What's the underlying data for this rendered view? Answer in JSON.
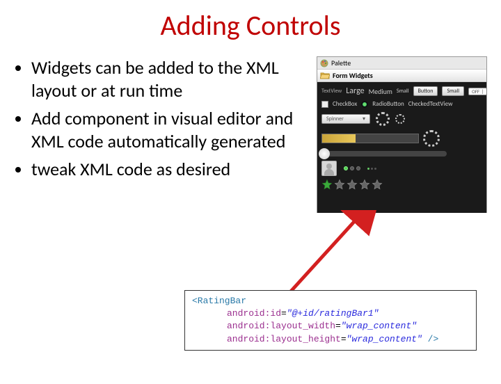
{
  "title": "Adding Controls",
  "bullets": [
    "Widgets can be added to the XML layout or at run time",
    "Add component in visual editor and XML code automatically generated",
    "tweak XML code as desired"
  ],
  "palette": {
    "header": "Palette",
    "section": "Form Widgets",
    "textview_label": "TextView",
    "large": "Large",
    "medium": "Medium",
    "small": "Small",
    "button": "Button",
    "small_btn": "Small",
    "off": "OFF",
    "checkbox": "CheckBox",
    "radio": "RadioButton",
    "checked_tv": "CheckedTextView",
    "spinner": "Spinner",
    "spinner_arrow": "▾",
    "rating": 1,
    "rating_max": 5
  },
  "code": {
    "tag_open": "<RatingBar",
    "attr1_name": "android:id",
    "attr1_val": "\"@+id/ratingBar1\"",
    "attr2_name": "android:layout_width",
    "attr2_val": "\"wrap_content\"",
    "attr3_name": "android:layout_height",
    "attr3_val": "\"wrap_content\"",
    "tag_close": " />",
    "eq": "="
  }
}
